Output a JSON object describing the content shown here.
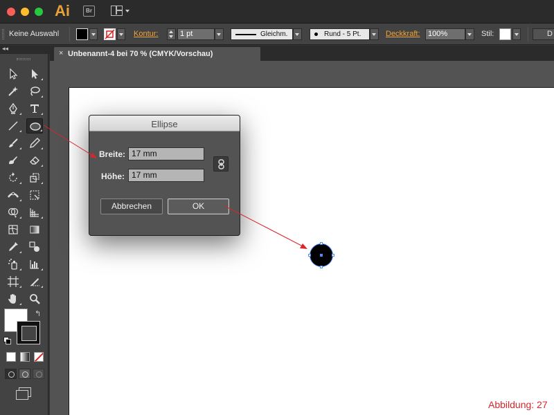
{
  "app": {
    "logo_text": "Ai",
    "bridge_button_label": "Br"
  },
  "control_bar": {
    "selection_label": "Keine Auswahl",
    "stroke_link_label": "Kontur:",
    "stroke_weight_value": "1 pt",
    "profile_label": "Gleichm.",
    "brush_label": "Rund - 5 Pt.",
    "opacity_link_label": "Deckkraft:",
    "opacity_value": "100%",
    "style_label": "Stil:",
    "doc_button_label": "D"
  },
  "document_tab": {
    "title": "Unbenannt-4 bei 70 % (CMYK/Vorschau)",
    "close_icon": "×"
  },
  "dialog": {
    "title": "Ellipse",
    "width_label": "Breite:",
    "width_value": "17 mm",
    "height_label": "Höhe:",
    "height_value": "17 mm",
    "link_icon": "chain-link-icon",
    "cancel_label": "Abbrechen",
    "ok_label": "OK"
  },
  "tools": [
    "selection-tool",
    "direct-selection-tool",
    "magic-wand-tool",
    "lasso-tool",
    "pen-tool",
    "type-tool",
    "line-segment-tool",
    "ellipse-tool",
    "paintbrush-tool",
    "pencil-tool",
    "blob-brush-tool",
    "eraser-tool",
    "rotate-tool",
    "scale-tool",
    "width-tool",
    "free-transform-tool",
    "shape-builder-tool",
    "perspective-grid-tool",
    "mesh-tool",
    "gradient-tool",
    "eyedropper-tool",
    "blend-tool",
    "symbol-sprayer-tool",
    "column-graph-tool",
    "artboard-tool",
    "slice-tool",
    "hand-tool",
    "zoom-tool"
  ],
  "active_tool": "ellipse-tool",
  "colors": {
    "fill": "#000000",
    "stroke": "none",
    "accent_link": "#f0a43a",
    "selection_blue": "#4f8df0",
    "annotation_red": "#d8262a"
  },
  "figure_label": "Abbildung: 27"
}
